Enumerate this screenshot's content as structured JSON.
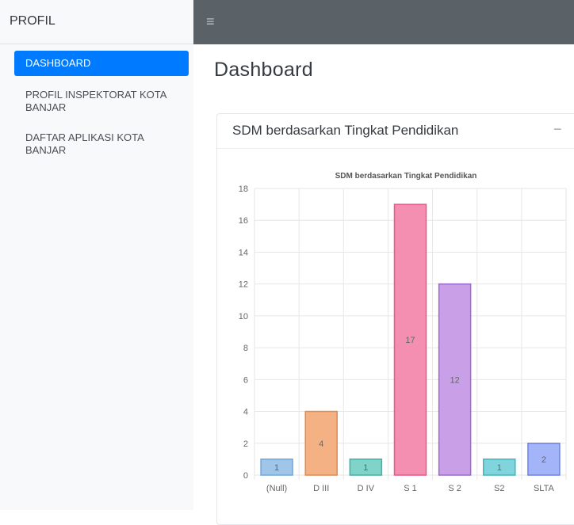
{
  "sidebar": {
    "brand": "PROFIL",
    "items": [
      {
        "lines": [
          "DASHBOARD"
        ],
        "active": true
      },
      {
        "lines": [
          "PROFIL INSPEKTORAT KOTA",
          "BANJAR"
        ],
        "active": false
      },
      {
        "lines": [
          "DAFTAR APLIKASI KOTA",
          "BANJAR"
        ],
        "active": false
      }
    ]
  },
  "topbar": {
    "menu_icon": "hamburger-menu-icon"
  },
  "main": {
    "page_title": "Dashboard"
  },
  "card": {
    "title": "SDM berdasarkan Tingkat Pendidikan",
    "collapse_symbol": "−"
  },
  "chart_data": {
    "type": "bar",
    "title": "SDM berdasarkan Tingkat Pendidikan",
    "categories": [
      "(Null)",
      "D III",
      "D IV",
      "S 1",
      "S 2",
      "S2",
      "SLTA"
    ],
    "values": [
      1,
      4,
      1,
      17,
      12,
      1,
      2
    ],
    "ylim": [
      0,
      18
    ],
    "yticks": [
      0,
      2,
      4,
      6,
      8,
      10,
      12,
      14,
      16,
      18
    ],
    "grid": true,
    "bar_colors": [
      "#9fc5e8",
      "#f4b183",
      "#7fd3c8",
      "#f48fb1",
      "#c9a0e8",
      "#80d4dc",
      "#a4b4f8"
    ],
    "border_colors": [
      "#6fa8dc",
      "#e08a4f",
      "#3fb3a3",
      "#e8578a",
      "#9b6ad1",
      "#3fb5c0",
      "#6b82ef"
    ]
  }
}
